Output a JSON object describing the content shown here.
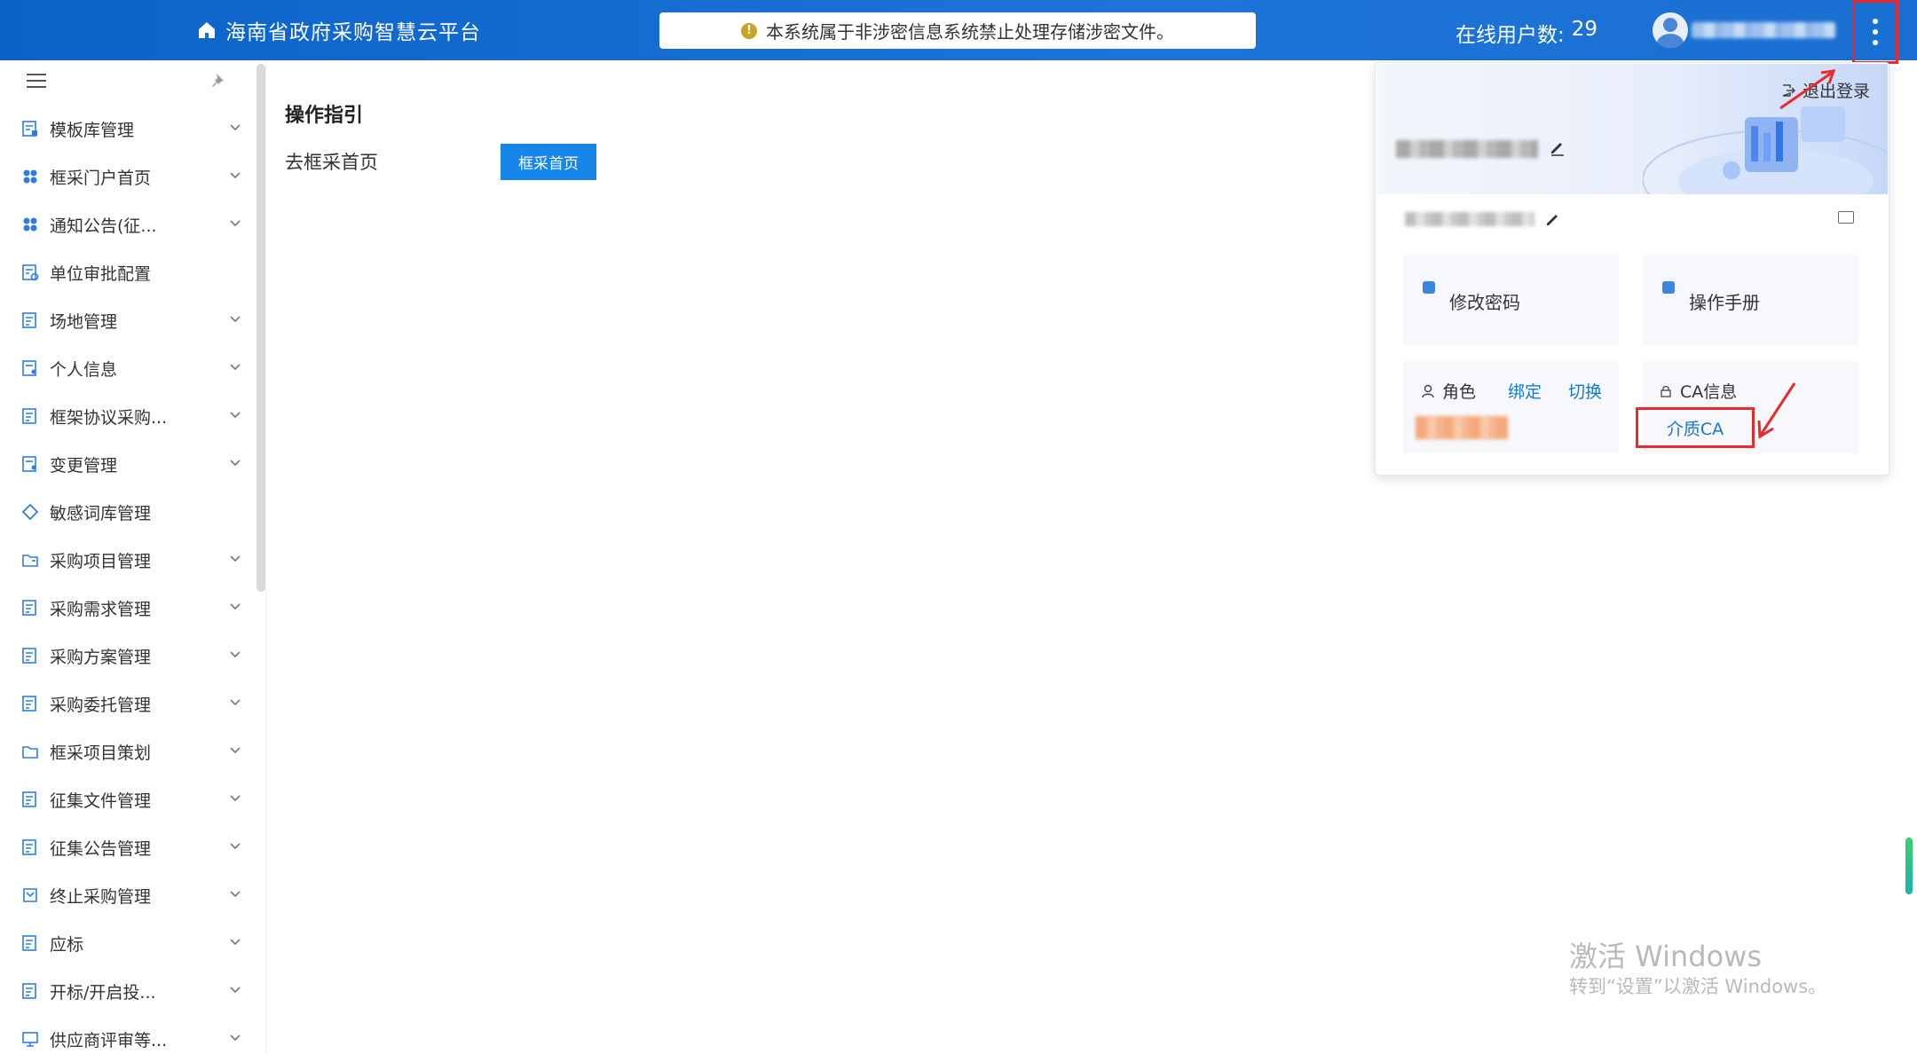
{
  "header": {
    "brand_title": "海南省政府采购智慧云平台",
    "notice": "本系统属于非涉密信息系统禁止处理存储涉密文件。",
    "online_label": "在线用户数:",
    "online_count": "29"
  },
  "sidebar": {
    "items": [
      {
        "label": "模板库管理",
        "icon": "template-icon",
        "expandable": true
      },
      {
        "label": "框采门户首页",
        "icon": "grid-icon",
        "expandable": true
      },
      {
        "label": "通知公告(征...",
        "icon": "grid-icon",
        "expandable": true
      },
      {
        "label": "单位审批配置",
        "icon": "doc-gear-icon",
        "expandable": false
      },
      {
        "label": "场地管理",
        "icon": "doc-icon",
        "expandable": true
      },
      {
        "label": "个人信息",
        "icon": "doc-user-icon",
        "expandable": true
      },
      {
        "label": "框架协议采购...",
        "icon": "doc-icon",
        "expandable": true
      },
      {
        "label": "变更管理",
        "icon": "doc-user-icon",
        "expandable": true
      },
      {
        "label": "敏感词库管理",
        "icon": "diamond-icon",
        "expandable": false
      },
      {
        "label": "采购项目管理",
        "icon": "folder-doc-icon",
        "expandable": true
      },
      {
        "label": "采购需求管理",
        "icon": "doc-icon",
        "expandable": true
      },
      {
        "label": "采购方案管理",
        "icon": "doc-icon",
        "expandable": true
      },
      {
        "label": "采购委托管理",
        "icon": "doc-icon",
        "expandable": true
      },
      {
        "label": "框采项目策划",
        "icon": "folder-icon",
        "expandable": true
      },
      {
        "label": "征集文件管理",
        "icon": "doc-icon",
        "expandable": true
      },
      {
        "label": "征集公告管理",
        "icon": "doc-icon",
        "expandable": true
      },
      {
        "label": "终止采购管理",
        "icon": "flow-icon",
        "expandable": true
      },
      {
        "label": "应标",
        "icon": "doc-icon",
        "expandable": true
      },
      {
        "label": "开标/开启投...",
        "icon": "doc-icon",
        "expandable": true
      },
      {
        "label": "供应商评审等...",
        "icon": "monitor-icon",
        "expandable": true
      }
    ]
  },
  "main": {
    "title": "操作指引",
    "goto_label": "去框采首页",
    "goto_button": "框采首页"
  },
  "panel": {
    "logout": "退出登录",
    "change_password": "修改密码",
    "manual": "操作手册",
    "role_label": "角色",
    "bind": "绑定",
    "switch": "切换",
    "ca_label": "CA信息",
    "ca_link": "介质CA"
  },
  "watermark": {
    "line1": "激活 Windows",
    "line2": "转到“设置”以激活 Windows。"
  },
  "colors": {
    "header": "#1a6fd2",
    "primary_button": "#1686e8",
    "link": "#1677d4",
    "annotation": "#e52b2b"
  }
}
